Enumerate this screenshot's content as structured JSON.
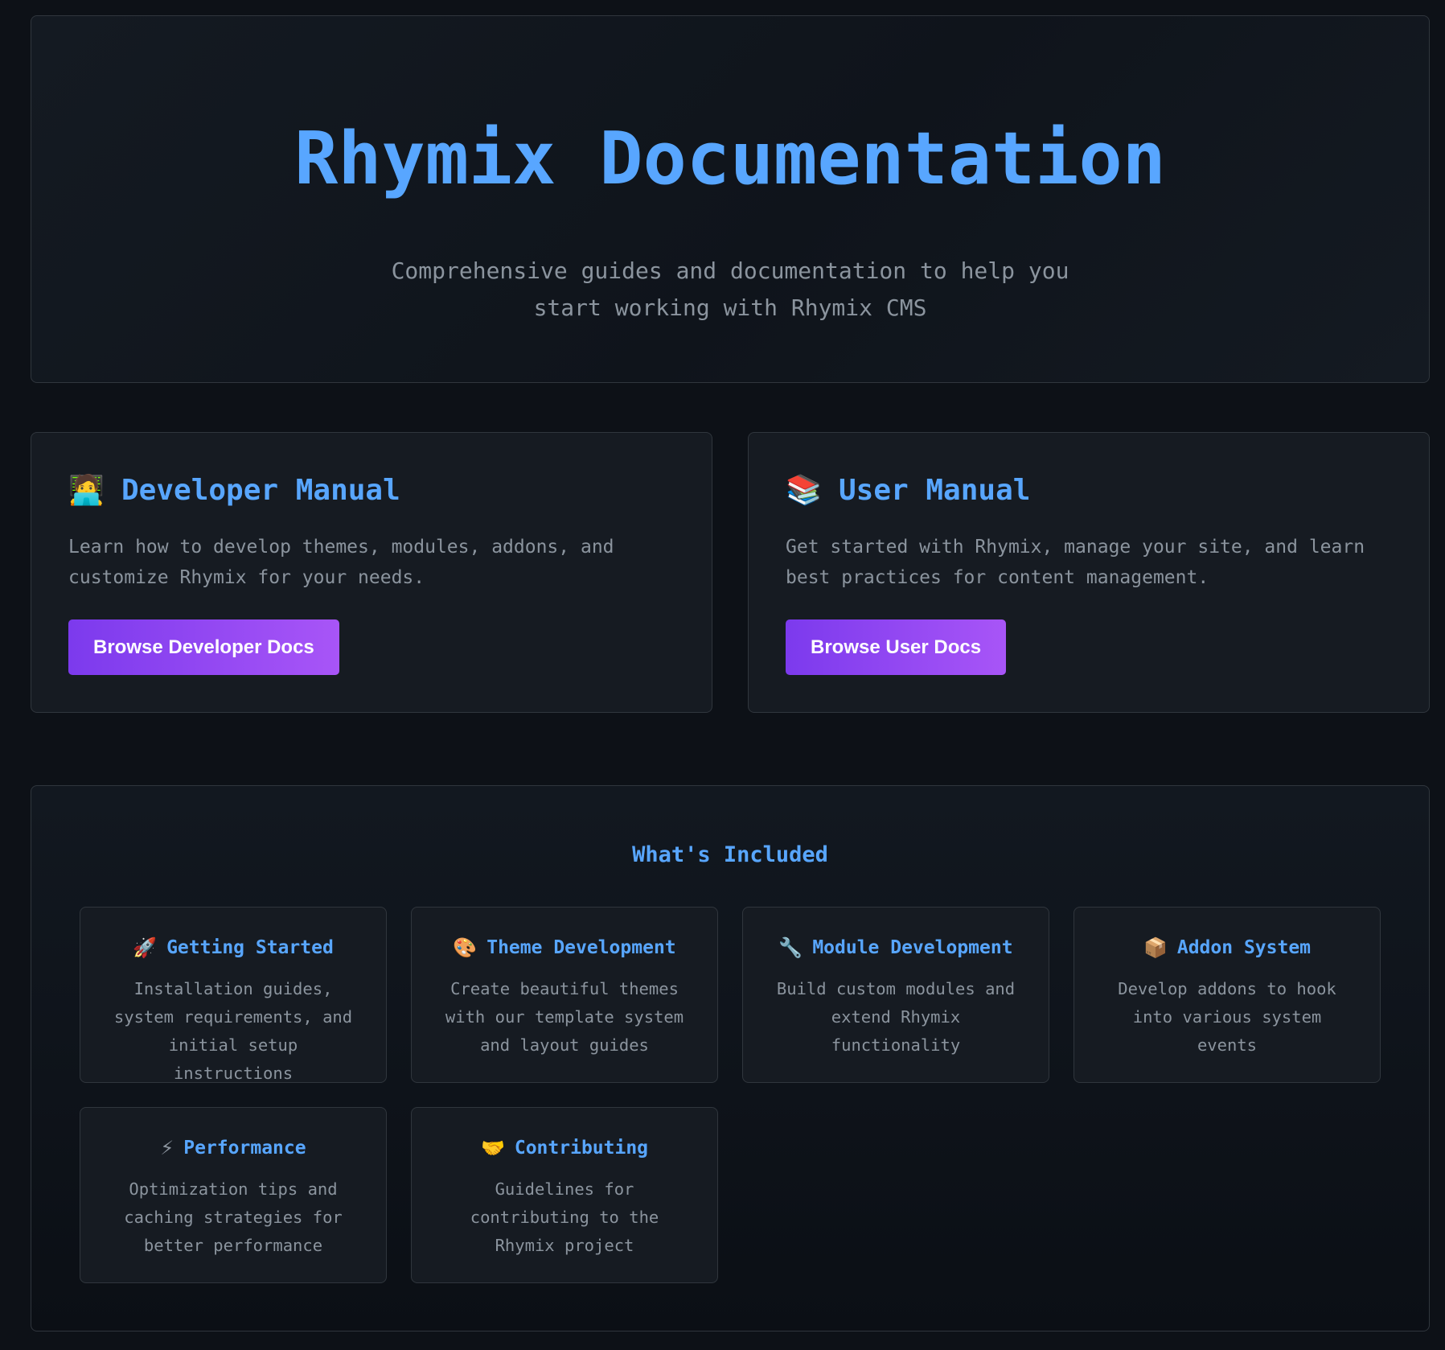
{
  "hero": {
    "title": "Rhymix Documentation",
    "subtitle": "Comprehensive guides and documentation to help you start working with Rhymix CMS"
  },
  "manuals": {
    "developer": {
      "icon": "🧑‍💻",
      "icon_name": "technologist-icon",
      "title": "Developer Manual",
      "description": "Learn how to develop themes, modules, addons, and customize Rhymix for your needs.",
      "button_label": "Browse Developer Docs"
    },
    "user": {
      "icon": "📚",
      "icon_name": "books-icon",
      "title": "User Manual",
      "description": "Get started with Rhymix, manage your site, and learn best practices for content management.",
      "button_label": "Browse User Docs"
    }
  },
  "included": {
    "title": "What's Included",
    "features": [
      {
        "icon": "🚀",
        "icon_name": "rocket-icon",
        "title": "Getting Started",
        "description": "Installation guides, system requirements, and initial setup instructions"
      },
      {
        "icon": "🎨",
        "icon_name": "palette-icon",
        "title": "Theme Development",
        "description": "Create beautiful themes with our template system and layout guides"
      },
      {
        "icon": "🔧",
        "icon_name": "wrench-icon",
        "title": "Module Development",
        "description": "Build custom modules and extend Rhymix functionality"
      },
      {
        "icon": "📦",
        "icon_name": "package-icon",
        "title": "Addon System",
        "description": "Develop addons to hook into various system events"
      },
      {
        "icon": "⚡",
        "icon_name": "lightning-icon",
        "title": "Performance",
        "description": "Optimization tips and caching strategies for better performance"
      },
      {
        "icon": "🤝",
        "icon_name": "handshake-icon",
        "title": "Contributing",
        "description": "Guidelines for contributing to the Rhymix project"
      }
    ]
  },
  "colors": {
    "background": "#0d1117",
    "card": "#161b22",
    "border": "#30363d",
    "accent": "#58a6ff",
    "button_start": "#7c3aed",
    "button_end": "#a855f7",
    "text_muted": "#8b949e"
  }
}
